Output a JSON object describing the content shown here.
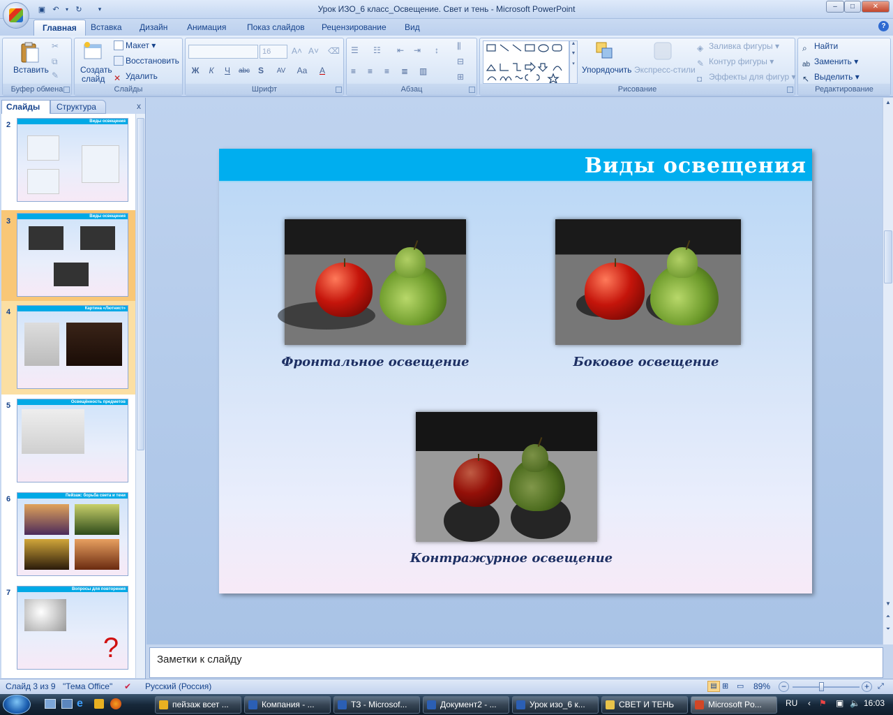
{
  "window": {
    "title": "Урок ИЗО_6 класс_Освещение. Свет и тень - Microsoft PowerPoint",
    "controls": {
      "minimize": "–",
      "maximize": "□",
      "close": "✕"
    }
  },
  "ribbon_tabs": [
    "Главная",
    "Вставка",
    "Дизайн",
    "Анимация",
    "Показ слайдов",
    "Рецензирование",
    "Вид"
  ],
  "active_tab": "Главная",
  "ribbon": {
    "clipboard": {
      "label": "Буфер обмена",
      "paste": "Вставить"
    },
    "slides": {
      "label": "Слайды",
      "create_line1": "Создать",
      "create_line2": "слайд",
      "layout": "Макет",
      "reset": "Восстановить",
      "delete": "Удалить"
    },
    "font": {
      "label": "Шрифт",
      "size": "16",
      "bold": "Ж",
      "italic": "К",
      "underline": "Ч",
      "strike": "abc",
      "shadow": "S",
      "spacing": "AV",
      "case": "Aa",
      "color": "A"
    },
    "paragraph": {
      "label": "Абзац"
    },
    "drawing": {
      "label": "Рисование",
      "arrange": "Упорядочить",
      "quick_styles": "Экспресс-стили",
      "fill": "Заливка фигуры",
      "outline": "Контур фигуры",
      "effects": "Эффекты для фигур"
    },
    "editing": {
      "label": "Редактирование",
      "find": "Найти",
      "replace": "Заменить",
      "select": "Выделить"
    }
  },
  "panel_tabs": {
    "slides": "Слайды",
    "outline": "Структура",
    "close": "x"
  },
  "thumbnails": [
    {
      "num": "2",
      "title": "Виды освещения"
    },
    {
      "num": "3",
      "title": "Виды освещения"
    },
    {
      "num": "4",
      "title": "Картина «Лютнист»"
    },
    {
      "num": "5",
      "title": "Освещённость предметов"
    },
    {
      "num": "6",
      "title": "Пейзаж: борьба света и тени"
    },
    {
      "num": "7",
      "title": "Вопросы для повторения"
    }
  ],
  "selected_slide": "3",
  "slide": {
    "title": "Виды освещения",
    "captions": {
      "frontal": "Фронтальное освещение",
      "side": "Боковое освещение",
      "back": "Контражурное освещение"
    }
  },
  "notes_placeholder": "Заметки к слайду",
  "status": {
    "slide_of": "Слайд 3 из 9",
    "theme": "\"Тема Office\"",
    "language": "Русский (Россия)",
    "zoom": "89%",
    "zoom_fraction": 0.89
  },
  "taskbar": {
    "items": [
      {
        "label": "пейзаж всет ...",
        "color": "#e8b021"
      },
      {
        "label": "Компания - ...",
        "color": "#2b5fb4"
      },
      {
        "label": "ТЗ - Microsof...",
        "color": "#2b5fb4"
      },
      {
        "label": "Документ2 - ...",
        "color": "#2b5fb4"
      },
      {
        "label": "Урок изо_6 к...",
        "color": "#2b5fb4"
      },
      {
        "label": "СВЕТ И ТЕНЬ",
        "color": "#e8c34a"
      },
      {
        "label": "Microsoft Po...",
        "color": "#d24726"
      }
    ],
    "lang": "RU",
    "time": "16:03"
  }
}
